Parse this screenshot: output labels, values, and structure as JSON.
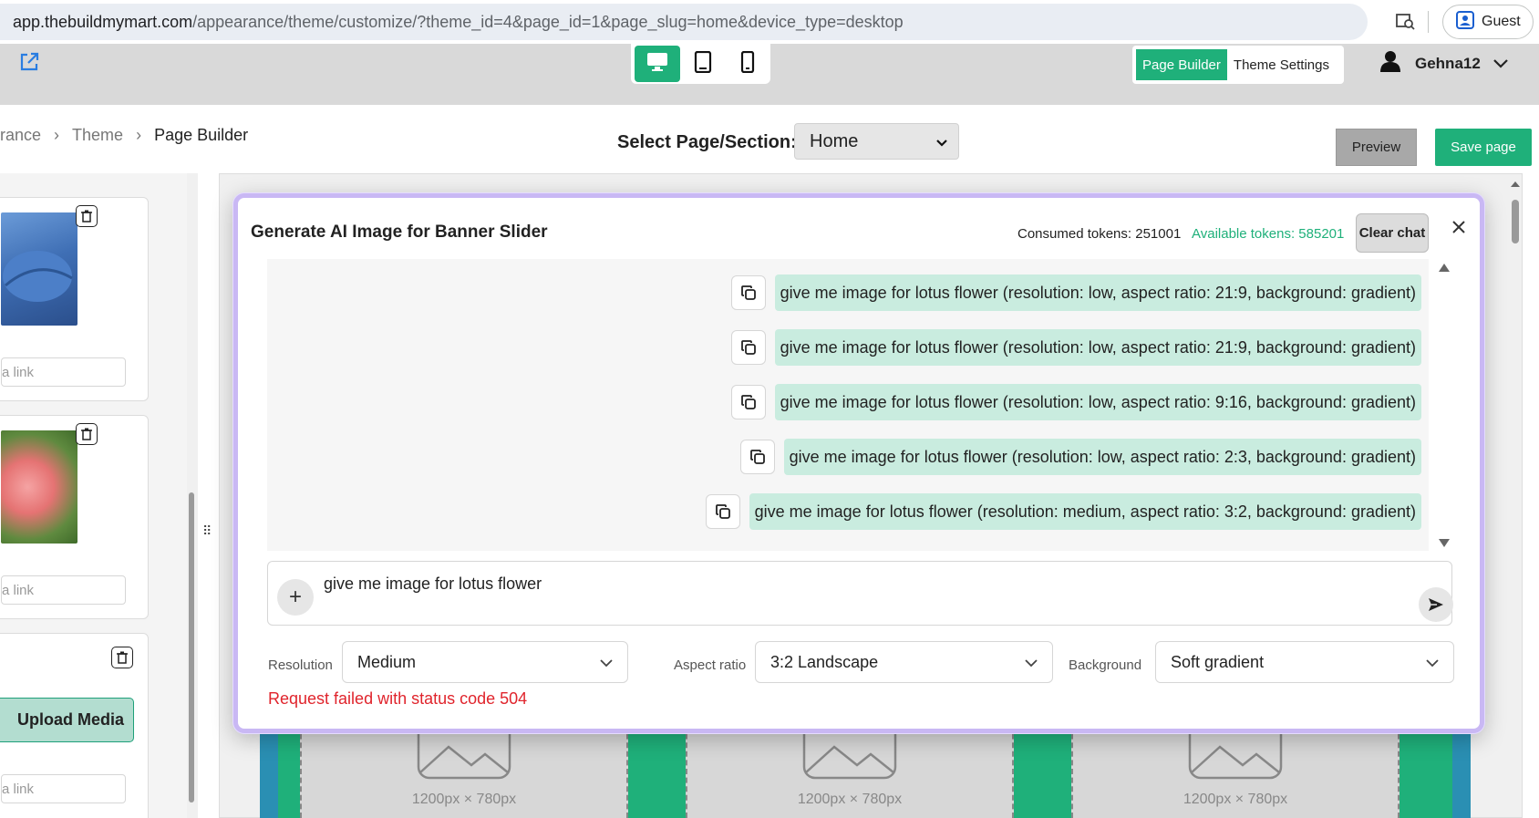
{
  "browser": {
    "url_host": "app.thebuildmymart.com",
    "url_path": "/appearance/theme/customize/?theme_id=4&page_id=1&page_slug=home&device_type=desktop",
    "guest_label": "Guest"
  },
  "topbar": {
    "page_builder_label": "Page Builder",
    "theme_settings_label": "Theme Settings",
    "username": "Gehna12"
  },
  "breadcrumb": {
    "item1": "rance",
    "item2": "Theme",
    "item3": "Page Builder"
  },
  "page_select": {
    "label": "Select Page/Section:",
    "value": "Home"
  },
  "actions": {
    "preview_label": "Preview",
    "save_label": "Save page"
  },
  "left_panel": {
    "link_placeholder": "a link",
    "upload_label": "Upload Media"
  },
  "canvas": {
    "placeholder_size": "1200px × 780px"
  },
  "modal": {
    "title": "Generate AI Image for Banner Slider",
    "consumed_tokens": "Consumed tokens: 251001",
    "available_tokens": "Available tokens: 585201",
    "clear_chat_label": "Clear chat",
    "messages": [
      "give me image for lotus flower (resolution: low, aspect ratio: 21:9, background: gradient)",
      "give me image for lotus flower (resolution: low, aspect ratio: 21:9, background: gradient)",
      "give me image for lotus flower (resolution: low, aspect ratio: 9:16, background: gradient)",
      "give me image for lotus flower (resolution: low, aspect ratio: 2:3, background: gradient)",
      "give me image for lotus flower (resolution: medium, aspect ratio: 3:2, background: gradient)"
    ],
    "input_value": "give me image for lotus flower",
    "options": {
      "resolution_label": "Resolution",
      "resolution_value": "Medium",
      "aspect_label": "Aspect ratio",
      "aspect_value": "3:2 Landscape",
      "background_label": "Background",
      "background_value": "Soft gradient"
    },
    "error": "Request failed with status code 504"
  },
  "colors": {
    "accent": "#1fb07a",
    "message_bg": "#c9ecdf",
    "error": "#e0242c",
    "modal_border": "#c9b8f4"
  }
}
